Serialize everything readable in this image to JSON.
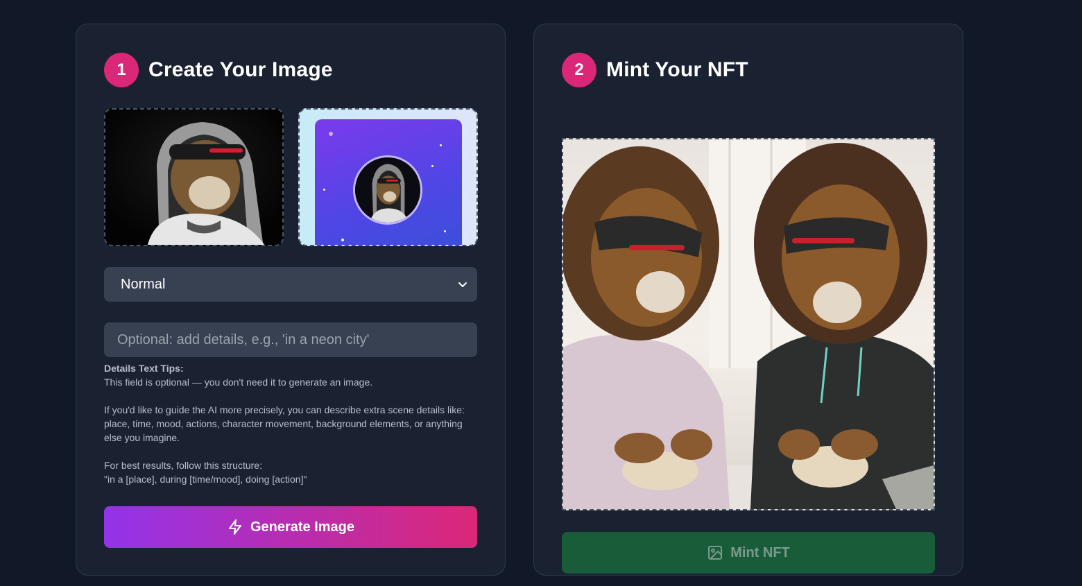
{
  "create_card": {
    "step_number": "1",
    "title": "Create Your Image",
    "mode_select": {
      "selected": "Normal"
    },
    "details_input": {
      "placeholder": "Optional: add details, e.g., 'in a neon city'",
      "value": ""
    },
    "tips": {
      "title": "Details Text Tips:",
      "line1": "This field is optional — you don't need it to generate an image.",
      "line2": "If you'd like to guide the AI more precisely, you can describe extra scene details like: place, time, mood, actions, character movement, background elements, or anything else you imagine.",
      "line3": "For best results, follow this structure:",
      "line4": "\"in a [place], during [time/mood], doing [action]\""
    },
    "generate_button": "Generate Image"
  },
  "mint_card": {
    "step_number": "2",
    "title": "Mint Your NFT",
    "mint_button": "Mint NFT"
  },
  "colors": {
    "background": "#111827",
    "card": "#1a2232",
    "step_badge": "#db2777",
    "generate_gradient_start": "#9333ea",
    "generate_gradient_end": "#db2777",
    "mint_button": "#185c3a"
  },
  "icons": {
    "generate": "lightning-icon",
    "mint": "image-icon",
    "select": "chevron-down-icon"
  }
}
